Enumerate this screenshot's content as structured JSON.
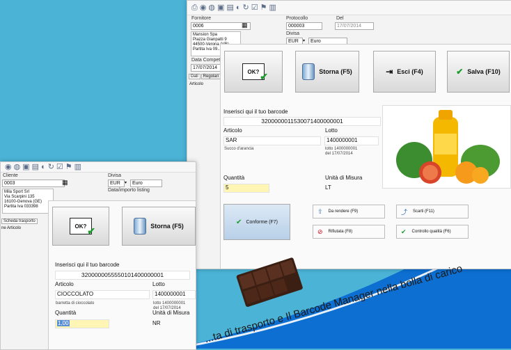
{
  "back": {
    "toolbar_icons": [
      "print-icon",
      "nav-icon",
      "shape-icon",
      "save-icon",
      "list-icon",
      "user-icon",
      "refresh-icon",
      "check-icon",
      "flag-icon",
      "chart-icon"
    ],
    "fornitore": {
      "label": "Fornitore",
      "code": "0006"
    },
    "protocollo": {
      "label": "Protocollo",
      "value": "000003"
    },
    "data": {
      "label": "Del",
      "value": "17/07/2014"
    },
    "divisa": {
      "label": "Divisa",
      "code": "EUR",
      "name": "Euro"
    },
    "address": "Mansion Spa\nPiazza Gianpatti 9\n44500-Verona (VR)\nPartita Iva 09...",
    "data_comp": {
      "label": "Data Competa",
      "value": "17/07/2014"
    },
    "tabs": [
      "Dati",
      "Regolari"
    ],
    "side_label": "Articolo",
    "buttons": {
      "ok": "OK?",
      "storna": "Storna (F5)",
      "esci": "Esci (F4)",
      "salva": "Salva (F10)"
    },
    "barcode_title": "Inserisci qui il tuo barcode",
    "barcode": "3200000011530071400000001",
    "articolo_label": "Articolo",
    "articolo": "SAR",
    "articolo_desc": "Succo d'arancia",
    "lotto_label": "Lotto",
    "lotto": "1400000001",
    "lotto_desc": "lotto 1400000001\ndel 17/07/2014",
    "quantita_label": "Quantità",
    "quantita": "5",
    "um_label": "Unità di Misura",
    "um": "LT",
    "actions": {
      "conforme": "Conforme (F7)",
      "rendere": "Da rendere (F9)",
      "scarti": "Scarti (F11)",
      "rifiutata": "Rifiutata (F8)",
      "controllo": "Controllo qualità (F6)"
    }
  },
  "front": {
    "cliente": {
      "label": "Cliente",
      "code": "0003"
    },
    "divisa": {
      "label": "Divisa",
      "code": "EUR",
      "name": "Euro"
    },
    "data_label": "Data/importo listing",
    "address": "Mila Sport Srl\nVia Scarpini 135\n16100-Genova (GE)\nPartita Iva 033398",
    "tab": "Scheda trasporto",
    "side_label": "ne Articolo",
    "buttons": {
      "ok": "OK?",
      "storna": "Storna (F5)"
    },
    "barcode_title": "Inserisci qui il tuo barcode",
    "barcode": "3200000055550101400000001",
    "articolo_label": "Articolo",
    "articolo": "CIOCCOLATO",
    "articolo_desc": "barretta di cioccolato",
    "lotto_label": "Lotto",
    "lotto": "1400000001",
    "lotto_desc": "lotto 1400000001\ndel 17/07/2014",
    "quantita_label": "Quantità",
    "quantita": "1,00",
    "um_label": "Unità di Misura",
    "um": "NR"
  },
  "caption": "...ta di trasporto e Il Barcode Manager nella bolla di carico",
  "colors": {
    "background": "#4bb3d6",
    "wave": "#0d6fd1",
    "ok_green": "#1a9c2a",
    "rifiutata_red": "#d0021b",
    "highlight": "#fff6b5"
  }
}
